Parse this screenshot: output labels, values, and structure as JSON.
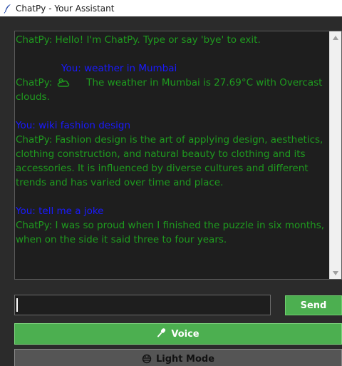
{
  "window": {
    "title": "ChatPy - Your Assistant",
    "icon": "feather-icon"
  },
  "chat": {
    "greeting": "ChatPy: Hello! I'm ChatPy. Type or say 'bye' to exit.",
    "weather_user": "You: weather in Mumbai",
    "weather_bot_prefix": "ChatPy:",
    "weather_icon": "cloud-icon",
    "weather_text": "The weather in Mumbai is 27.69°C with Overcast",
    "weather_text_cont": "clouds.",
    "wiki_user": "You: wiki fashion design",
    "wiki_bot": "ChatPy: Fashion design is the art of applying design, aesthetics, clothing construction, and natural beauty to clothing and its accessories. It is influenced by diverse cultures and different trends and has varied over time and place.",
    "joke_user": "You: tell me a joke",
    "joke_bot": "ChatPy: I was so proud when I finished the puzzle in six months, when on the side it said three to four years."
  },
  "input": {
    "value": "",
    "placeholder": ""
  },
  "buttons": {
    "send": "Send",
    "voice": "Voice",
    "voice_icon": "microphone-icon",
    "mode": "Light Mode",
    "mode_icon": "theme-icon"
  },
  "colors": {
    "bot_text": "#1f9b1f",
    "user_text": "#1a1aff",
    "accent_green": "#4caf50",
    "chat_bg": "#1e1e1e",
    "window_bg": "#2b2b2b"
  }
}
